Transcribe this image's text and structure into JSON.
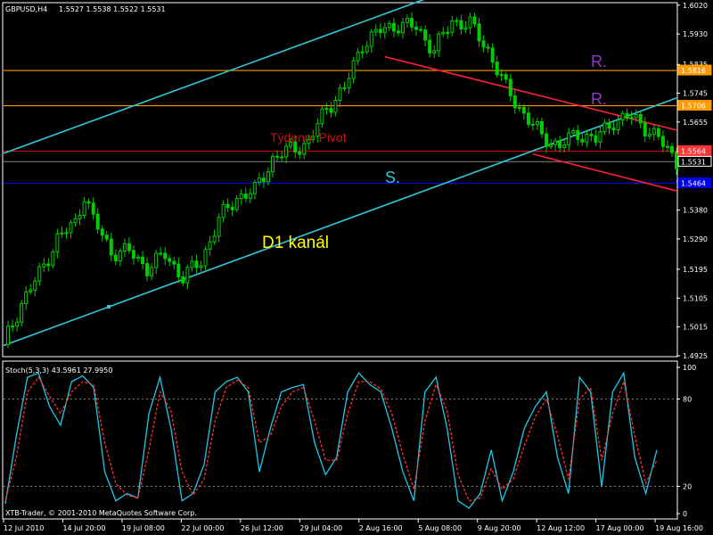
{
  "header": {
    "symbol": "GBPUSD,H4",
    "ohlc": "1.5527 1.5538 1.5522 1.5531"
  },
  "stoch_header": "Stoch(5,3,3) 43.5961 27.9950",
  "copyright": "XTB-Trader, © 2001-2010 MetaQuotes Software Corp.",
  "annotations": {
    "pivot": "Týdenní Pivot",
    "channel": "D1 kanál",
    "r1": "R.",
    "r2": "R.",
    "s": "S."
  },
  "colors": {
    "background": "#000000",
    "candle": "#00cc00",
    "channel": "#2fc8d8",
    "orange": "#ff9900",
    "red": "#ff1f3a",
    "pivot_line": "#cc0000",
    "support": "#0000ee",
    "purple": "#9933cc",
    "stoch_main": "#20c8e8",
    "stoch_signal": "#ff3030"
  },
  "chart_data": [
    {
      "type": "candlestick",
      "symbol": "GBPUSD",
      "timeframe": "H4",
      "ylim": [
        1.4925,
        1.6025
      ],
      "yticks": [
        "1.6020",
        "1.5930",
        "1.5835",
        "1.5745",
        "1.5655",
        "1.5560",
        "1.5470",
        "1.5380",
        "1.5290",
        "1.5195",
        "1.5105",
        "1.5015",
        "1.4925"
      ],
      "xticks": [
        "12 Jul 2010",
        "14 Jul 20:00",
        "19 Jul 08:00",
        "22 Jul 00:00",
        "26 Jul 12:00",
        "29 Jul 04:00",
        "2 Aug 16:00",
        "5 Aug 08:00",
        "9 Aug 20:00",
        "12 Aug 12:00",
        "17 Aug 00:00",
        "19 Aug 16:00"
      ],
      "close_path": [
        [
          0,
          1.496
        ],
        [
          4,
          1.509
        ],
        [
          8,
          1.518
        ],
        [
          12,
          1.529
        ],
        [
          16,
          1.534
        ],
        [
          18,
          1.543
        ],
        [
          20,
          1.535
        ],
        [
          24,
          1.525
        ],
        [
          28,
          1.525
        ],
        [
          32,
          1.52
        ],
        [
          36,
          1.524
        ],
        [
          40,
          1.517
        ],
        [
          44,
          1.522
        ],
        [
          48,
          1.535
        ],
        [
          52,
          1.542
        ],
        [
          56,
          1.544
        ],
        [
          60,
          1.554
        ],
        [
          64,
          1.557
        ],
        [
          68,
          1.559
        ],
        [
          72,
          1.57
        ],
        [
          76,
          1.576
        ],
        [
          80,
          1.59
        ],
        [
          84,
          1.594
        ],
        [
          88,
          1.596
        ],
        [
          92,
          1.595
        ],
        [
          96,
          1.588
        ],
        [
          100,
          1.597
        ],
        [
          104,
          1.596
        ],
        [
          108,
          1.588
        ],
        [
          112,
          1.576
        ],
        [
          116,
          1.568
        ],
        [
          120,
          1.561
        ],
        [
          124,
          1.558
        ],
        [
          128,
          1.562
        ],
        [
          132,
          1.56
        ],
        [
          136,
          1.566
        ],
        [
          140,
          1.567
        ],
        [
          144,
          1.563
        ],
        [
          148,
          1.557
        ],
        [
          150,
          1.553
        ]
      ],
      "price_labels": [
        {
          "value": 1.5816,
          "text": "1.5816",
          "color": "#ff9900"
        },
        {
          "value": 1.5706,
          "text": "1.5706",
          "color": "#ff9900"
        },
        {
          "value": 1.5564,
          "text": "1.5564",
          "color": "#ff3333"
        },
        {
          "value": 1.5531,
          "text": "1.5531",
          "color": "#ffffff"
        },
        {
          "value": 1.5464,
          "text": "1.5464",
          "color": "#0000ee"
        }
      ],
      "hlines": [
        {
          "value": 1.5816,
          "color": "#ff9900"
        },
        {
          "value": 1.5706,
          "color": "#ff9900"
        },
        {
          "value": 1.5564,
          "color": "#cc0000"
        },
        {
          "value": 1.5531,
          "color": "#666666"
        },
        {
          "value": 1.5464,
          "color": "#0000ee"
        }
      ],
      "trend_lines": [
        {
          "name": "channel-upper",
          "from": [
            0,
            1.5557
          ],
          "to": [
            100,
            1.607
          ],
          "color": "#2fc8d8"
        },
        {
          "name": "channel-lower",
          "from": [
            0,
            1.4957
          ],
          "to": [
            150,
            1.573
          ],
          "color": "#2fc8d8"
        },
        {
          "name": "down-upper",
          "from": [
            85,
            1.5859
          ],
          "to": [
            150,
            1.563
          ],
          "color": "#ff1f3a"
        },
        {
          "name": "down-lower",
          "from": [
            118,
            1.5555
          ],
          "to": [
            150,
            1.544
          ],
          "color": "#ff1f3a"
        }
      ]
    },
    {
      "type": "line",
      "name": "Stoch(5,3,3)",
      "ylim": [
        0,
        100
      ],
      "yticks": [
        "100",
        "80",
        "20",
        "0"
      ],
      "levels": [
        80,
        20
      ],
      "series": [
        {
          "name": "main",
          "values": [
            8,
            55,
            95,
            98,
            75,
            62,
            92,
            96,
            88,
            30,
            10,
            15,
            12,
            70,
            95,
            60,
            10,
            15,
            35,
            85,
            92,
            95,
            85,
            30,
            60,
            85,
            88,
            90,
            50,
            28,
            40,
            85,
            98,
            90,
            85,
            60,
            30,
            10,
            85,
            95,
            60,
            10,
            5,
            15,
            45,
            10,
            30,
            60,
            75,
            85,
            40,
            15,
            95,
            85,
            20,
            85,
            98,
            40,
            15,
            45
          ]
        },
        {
          "name": "signal",
          "values": [
            10,
            40,
            85,
            95,
            82,
            70,
            85,
            92,
            90,
            50,
            22,
            14,
            12,
            45,
            85,
            72,
            30,
            14,
            25,
            65,
            88,
            93,
            88,
            50,
            55,
            75,
            85,
            88,
            65,
            38,
            38,
            70,
            92,
            92,
            87,
            70,
            42,
            18,
            65,
            90,
            72,
            28,
            10,
            12,
            32,
            18,
            25,
            48,
            68,
            80,
            55,
            25,
            80,
            88,
            38,
            70,
            92,
            55,
            22,
            38
          ]
        }
      ]
    }
  ]
}
